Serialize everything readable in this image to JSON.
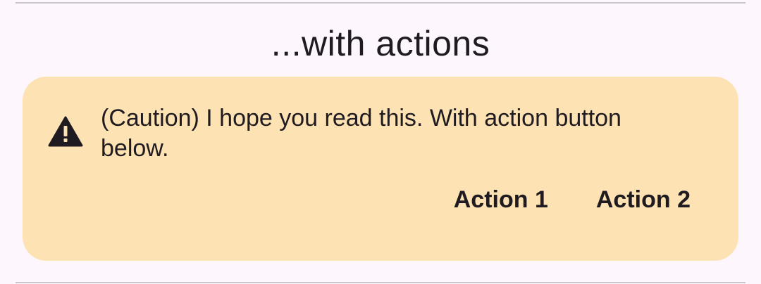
{
  "section": {
    "title": "...with actions"
  },
  "banner": {
    "icon": "warning-triangle-icon",
    "message": "(Caution) I hope you read this. With action button below.",
    "background_color": "#FDE2B3",
    "actions": [
      {
        "label": "Action 1"
      },
      {
        "label": "Action 2"
      }
    ]
  }
}
